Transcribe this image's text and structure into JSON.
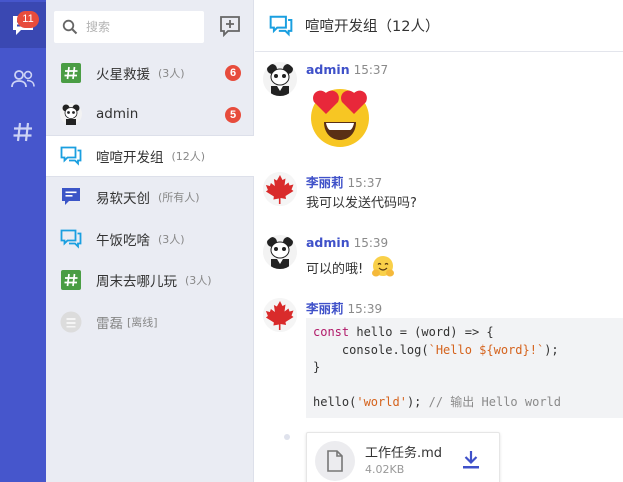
{
  "rail": {
    "chat_badge": "11",
    "icons": [
      "chat-bubble-icon",
      "contacts-icon",
      "hashtag-icon"
    ],
    "color": "#4656cc"
  },
  "search": {
    "placeholder": "搜索"
  },
  "sessions": [
    {
      "name": "火星救援",
      "count": "(3人)",
      "icon": "hashtag-icon",
      "badge": "6"
    },
    {
      "name": "admin",
      "count": "",
      "icon": "panda-avatar",
      "badge": "5"
    },
    {
      "name": "喧喧开发组",
      "count": "(12人)",
      "icon": "group-chat-icon",
      "badge": "",
      "active": true
    },
    {
      "name": "易软天创",
      "count": "(所有人)",
      "icon": "notice-icon",
      "badge": ""
    },
    {
      "name": "午饭吃啥",
      "count": "(3人)",
      "icon": "group-chat-icon",
      "badge": ""
    },
    {
      "name": "周末去哪儿玩",
      "count": "(3人)",
      "icon": "hashtag-icon",
      "badge": ""
    },
    {
      "name": "雷磊",
      "count": "[离线]",
      "icon": "offline-user-icon",
      "badge": ""
    }
  ],
  "chat": {
    "title": "喧喧开发组（12人）",
    "messages": [
      {
        "author": "admin",
        "time": "15:37",
        "content_type": "emoji",
        "emoji": "heart-eyes-emoji"
      },
      {
        "author": "李丽莉",
        "time": "15:37",
        "text": "我可以发送代码吗?"
      },
      {
        "author": "admin",
        "time": "15:39",
        "text": "可以的哦!",
        "emoji": "hug-emoji"
      },
      {
        "author": "李丽莉",
        "time": "15:39",
        "code": {
          "line1_kw": "const",
          "line1_rest": " hello = (word) => {",
          "line2_pre": "    console.log(",
          "line2_str": "`Hello ${word}!`",
          "line2_post": ");",
          "line3": "}",
          "line5_pre": "hello(",
          "line5_str": "'world'",
          "line5_post": "); ",
          "line5_comment": "// 输出 Hello world"
        }
      }
    ],
    "file": {
      "name": "工作任务.md",
      "size": "4.02KB"
    }
  },
  "colors": {
    "accent": "#4656cc",
    "badge": "#e74c3c",
    "hashtag_green": "#4a9d44",
    "group_blue": "#1a9fe0",
    "notice_blue": "#3b55c7",
    "author_admin": "#3f51c9",
    "author_other": "#3f51c9"
  }
}
